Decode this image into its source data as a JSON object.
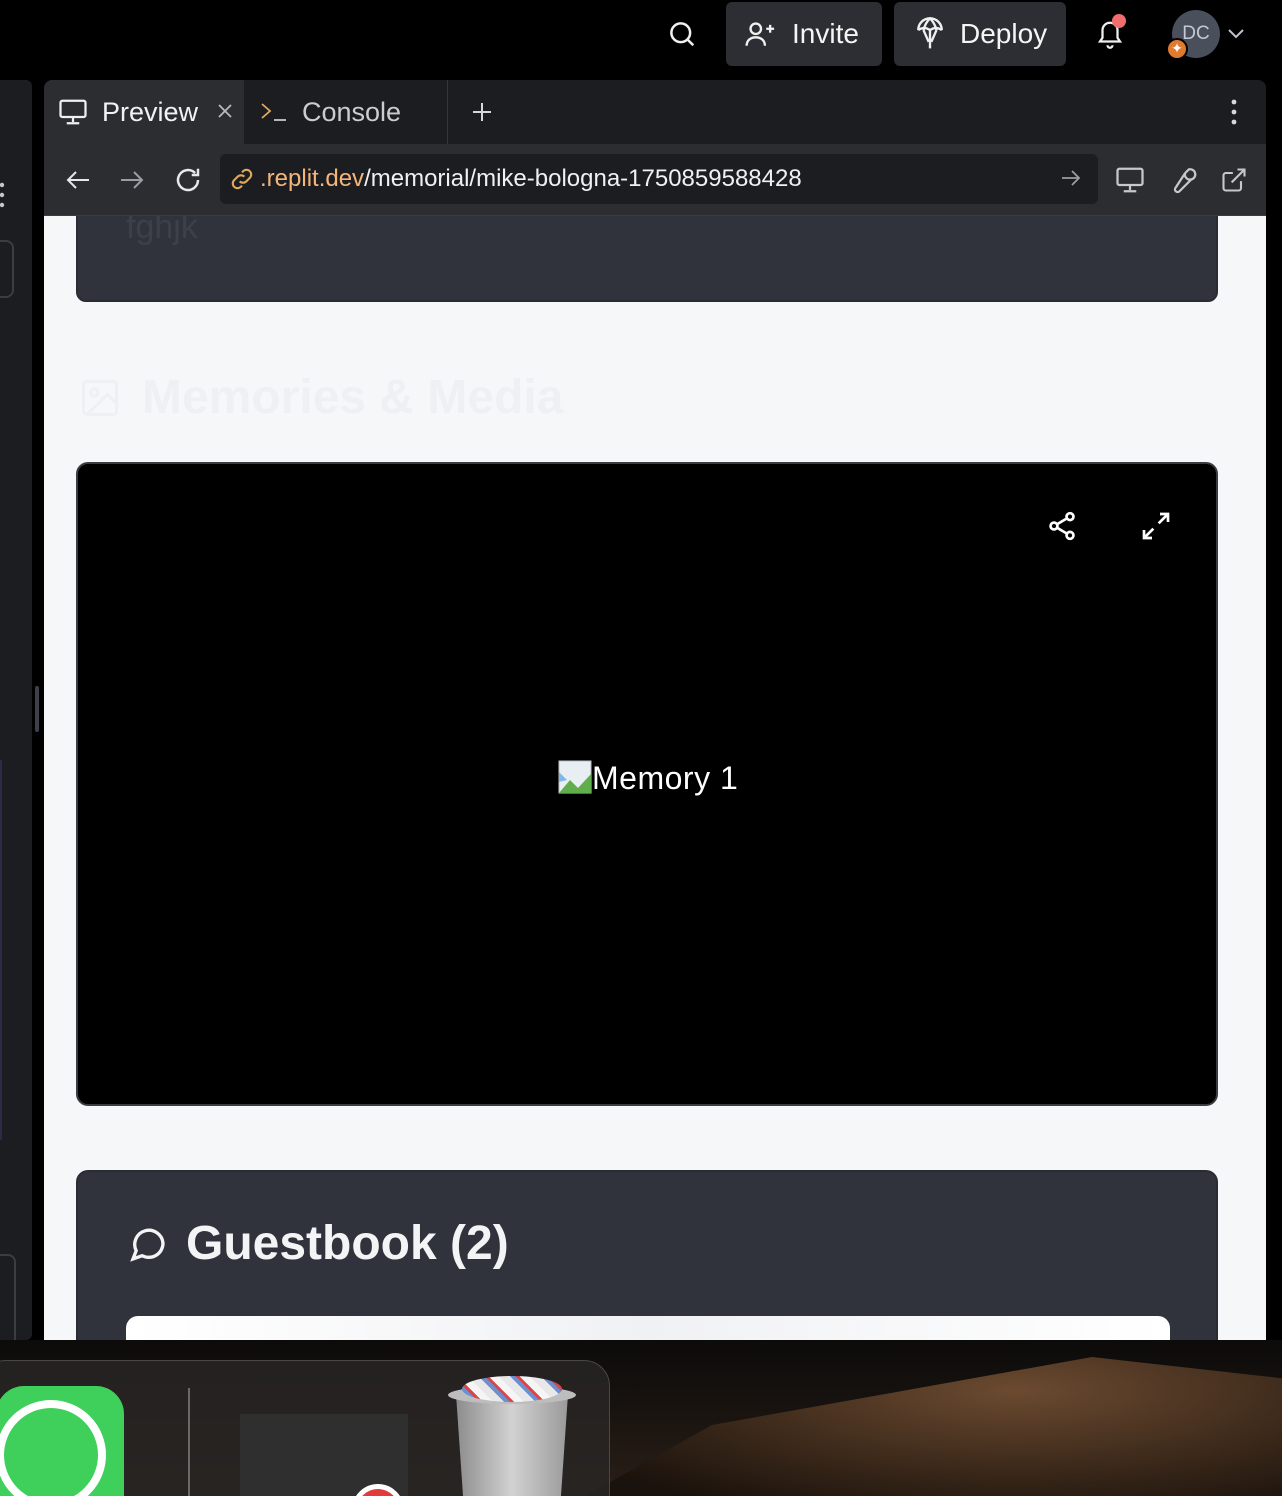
{
  "topbar": {
    "invite_label": "Invite",
    "deploy_label": "Deploy",
    "avatar_initials": "DC",
    "notification_color": "#f26d6d"
  },
  "tabs": [
    {
      "label": "Preview",
      "icon": "monitor-icon",
      "active": true
    },
    {
      "label": "Console",
      "icon": "terminal-icon",
      "active": false
    }
  ],
  "address": {
    "host": ".replit.dev",
    "path": "/memorial/mike-bologna-1750859588428"
  },
  "page": {
    "top_card_text": "fghjk",
    "media_heading": "Memories & Media",
    "media_image_alt": "Memory 1",
    "guestbook_title": "Guestbook (2)"
  },
  "colors": {
    "accent_host": "#f4b57a",
    "pill_bg": "#2c2e33",
    "card_bg": "#30333b",
    "page_bg": "#f6f7f9"
  }
}
